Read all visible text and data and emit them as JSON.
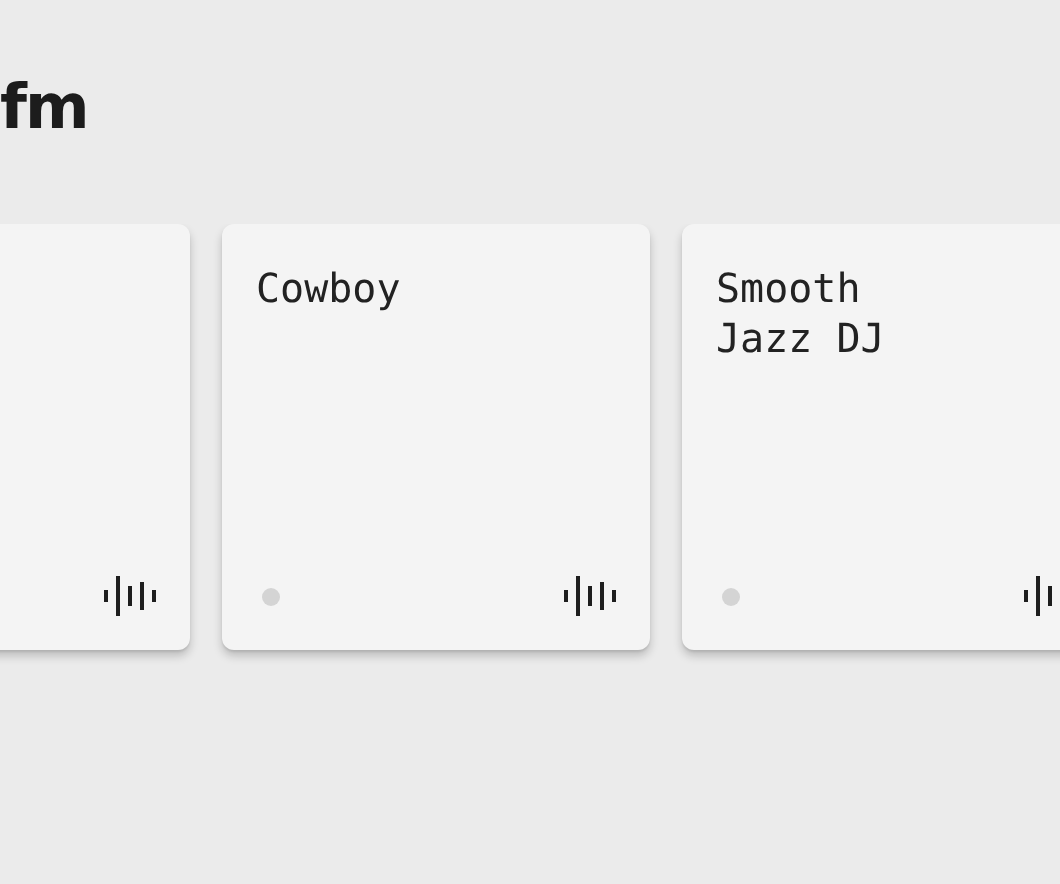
{
  "brand": {
    "text": "fm"
  },
  "stations": [
    {
      "kind": "partial"
    },
    {
      "kind": "full",
      "name": "Cowboy"
    },
    {
      "kind": "full",
      "name": "Smooth Jazz DJ"
    }
  ]
}
